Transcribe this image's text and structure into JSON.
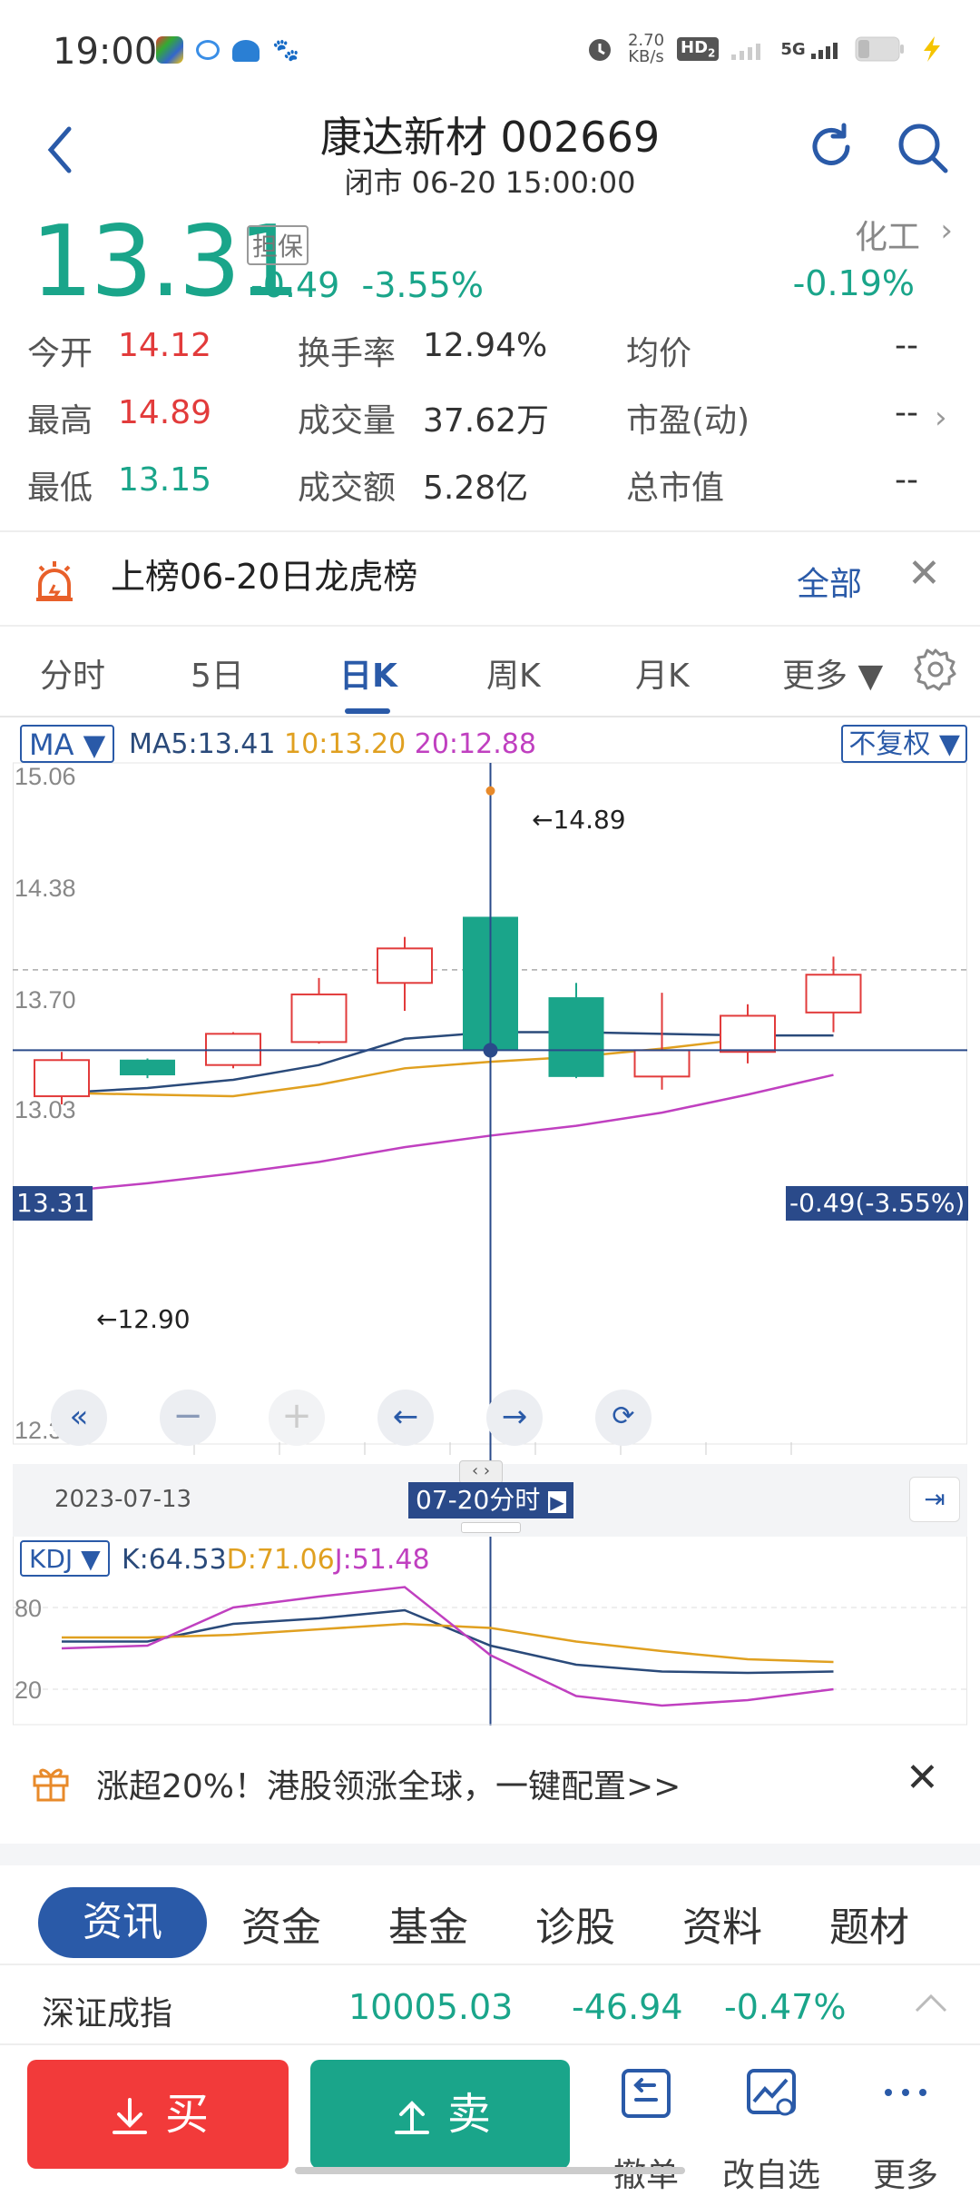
{
  "status": {
    "time": "19:00",
    "net_speed": "2.70\nKB/s",
    "net_speed_top": "2.70",
    "net_speed_bottom": "KB/s",
    "hd": "HD",
    "hd_sub": "2",
    "signal": "5G"
  },
  "header": {
    "title": "康达新材 002669",
    "subtitle": "闭市 06-20 15:00:00"
  },
  "quote": {
    "price": "13.31",
    "badge": "担保",
    "change": "-0.49",
    "change_pct": "-3.55%",
    "sector": "化工",
    "sector_chg": "-0.19%",
    "rows": [
      [
        {
          "label": "今开",
          "value": "14.12",
          "color": "red"
        },
        {
          "label": "换手率",
          "value": "12.94%",
          "color": "gray"
        },
        {
          "label": "均价",
          "value": "--",
          "color": "gray"
        }
      ],
      [
        {
          "label": "最高",
          "value": "14.89",
          "color": "red"
        },
        {
          "label": "成交量",
          "value": "37.62万",
          "color": "gray"
        },
        {
          "label": "市盈(动)",
          "value": "--",
          "color": "gray"
        }
      ],
      [
        {
          "label": "最低",
          "value": "13.15",
          "color": "green"
        },
        {
          "label": "成交额",
          "value": "5.28亿",
          "color": "gray"
        },
        {
          "label": "总市值",
          "value": "--",
          "color": "gray"
        }
      ]
    ]
  },
  "banner": {
    "text": "上榜06-20日龙虎榜",
    "all": "全部"
  },
  "tabs": [
    "分时",
    "5日",
    "日K",
    "周K",
    "月K",
    "更多 ▼"
  ],
  "active_tab": "日K",
  "chart_labels": {
    "ma_selector": "MA ▼",
    "ma5": "MA5:13.41",
    "ma10": "10:13.20",
    "ma20": "20:12.88",
    "adjust": "不复权 ▼",
    "high_mark": "←14.89",
    "low_mark": "←12.90",
    "price_tag": "13.31",
    "change_tag": "-0.49(-3.55%)",
    "date_start": "2023-07-13",
    "date_cursor": "07-20分时",
    "kdj_selector": "KDJ ▼",
    "k": "K:64.53",
    "d": "D:71.06",
    "j": "J:51.48"
  },
  "chart_data": [
    {
      "type": "candlestick",
      "title": "",
      "y_ticks": [
        "15.06",
        "14.38",
        "13.70",
        "13.03",
        "12.35"
      ],
      "ylim": [
        12.35,
        15.06
      ],
      "reference_line": 13.8,
      "candles": [
        {
          "open": 13.03,
          "close": 13.25,
          "high": 13.3,
          "low": 12.98,
          "dir": "up"
        },
        {
          "open": 13.25,
          "close": 13.16,
          "high": 13.26,
          "low": 13.14,
          "dir": "down"
        },
        {
          "open": 13.22,
          "close": 13.41,
          "high": 13.42,
          "low": 13.2,
          "dir": "up"
        },
        {
          "open": 13.36,
          "close": 13.65,
          "high": 13.75,
          "low": 13.35,
          "dir": "up"
        },
        {
          "open": 13.72,
          "close": 13.93,
          "high": 14.0,
          "low": 13.55,
          "dir": "up"
        },
        {
          "open": 14.12,
          "close": 13.31,
          "high": 14.89,
          "low": 13.31,
          "dir": "down"
        },
        {
          "open": 13.63,
          "close": 13.15,
          "high": 13.72,
          "low": 13.14,
          "dir": "down"
        },
        {
          "open": 13.15,
          "close": 13.31,
          "high": 13.66,
          "low": 13.07,
          "dir": "up"
        },
        {
          "open": 13.3,
          "close": 13.52,
          "high": 13.59,
          "low": 13.23,
          "dir": "up"
        },
        {
          "open": 13.54,
          "close": 13.77,
          "high": 13.88,
          "low": 13.42,
          "dir": "up"
        }
      ],
      "ma_series": [
        {
          "name": "MA5",
          "color": "#2a4a7a",
          "values": [
            13.05,
            13.08,
            13.13,
            13.22,
            13.38,
            13.42,
            13.42,
            13.41,
            13.4,
            13.4
          ]
        },
        {
          "name": "MA10",
          "color": "#e0a020",
          "values": [
            13.05,
            13.04,
            13.03,
            13.1,
            13.2,
            13.24,
            13.27,
            13.32,
            13.38,
            null
          ]
        },
        {
          "name": "MA20",
          "color": "#c040c0",
          "values": [
            12.45,
            12.5,
            12.56,
            12.63,
            12.72,
            12.79,
            12.85,
            12.93,
            13.04,
            13.16
          ]
        }
      ]
    },
    {
      "type": "line",
      "title": "",
      "y_ticks": [
        "80",
        "20"
      ],
      "ylim": [
        0,
        100
      ],
      "series": [
        {
          "name": "K",
          "color": "#2a4a7a",
          "values": [
            55,
            55,
            68,
            72,
            78,
            52,
            38,
            33,
            32,
            33
          ]
        },
        {
          "name": "D",
          "color": "#e0a020",
          "values": [
            58,
            58,
            60,
            64,
            68,
            65,
            55,
            48,
            42,
            40
          ]
        },
        {
          "name": "J",
          "color": "#c040c0",
          "values": [
            50,
            52,
            80,
            88,
            95,
            45,
            15,
            8,
            12,
            20
          ]
        }
      ]
    }
  ],
  "promo": {
    "text": "涨超20%！港股领涨全球，一键配置>>"
  },
  "news_tabs": [
    "资讯",
    "资金",
    "基金",
    "诊股",
    "资料",
    "题材"
  ],
  "index": {
    "name": "深证成指",
    "value": "10005.03",
    "change": "-46.94",
    "pct": "-0.47%"
  },
  "bottom": {
    "buy": "买",
    "sell": "卖",
    "cancel": "撤单",
    "edit": "改自选",
    "more": "更多"
  }
}
